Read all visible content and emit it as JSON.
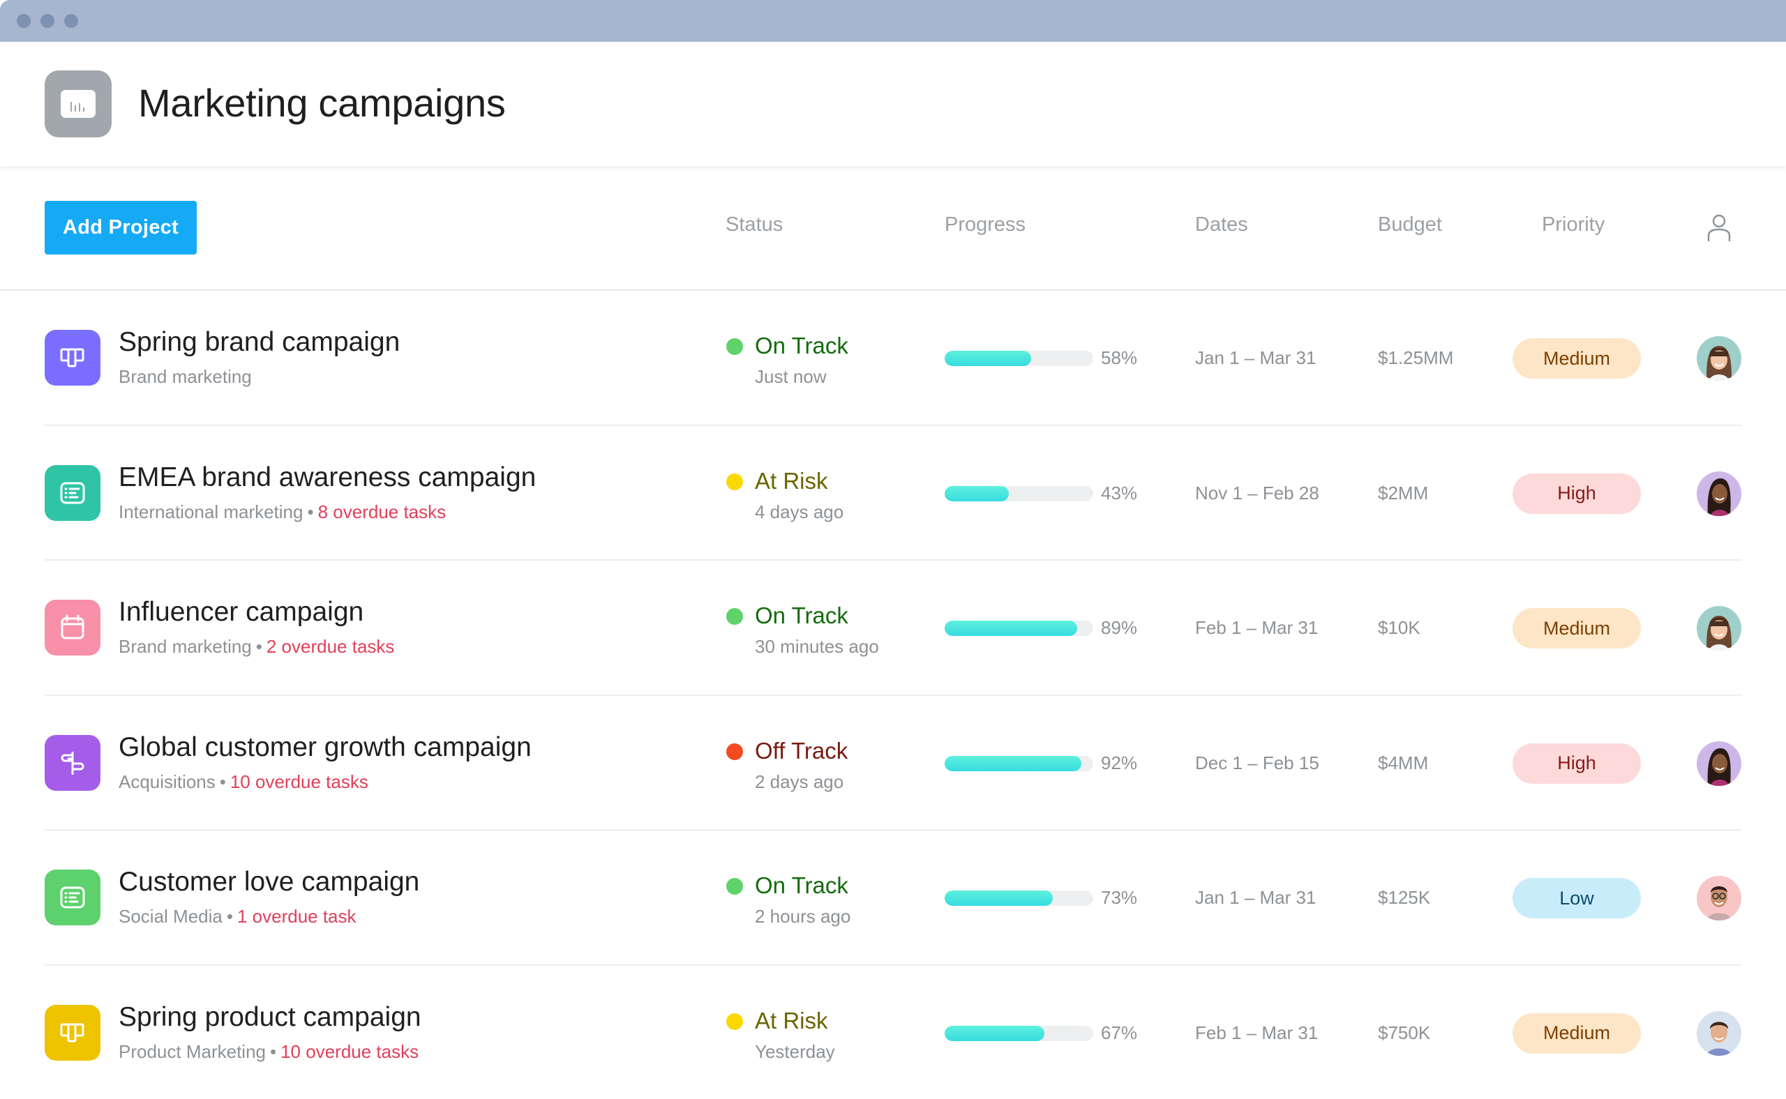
{
  "window": {
    "controls": [
      "close",
      "minimize",
      "maximize"
    ]
  },
  "header": {
    "icon": "bar-chart-icon",
    "title": "Marketing campaigns"
  },
  "toolbar": {
    "add_project_label": "Add Project",
    "columns": {
      "status": "Status",
      "progress": "Progress",
      "dates": "Dates",
      "budget": "Budget",
      "priority": "Priority",
      "assignee_icon": "person-icon"
    }
  },
  "colors": {
    "titlebar": "#a6b6cf",
    "accent": "#14aaf5",
    "overdue": "#e0405a",
    "progress_fill": "#37dce0"
  },
  "projects": [
    {
      "name": "Spring brand campaign",
      "team": "Brand marketing",
      "overdue": "",
      "icon": "board-icon",
      "icon_color": "#796eff",
      "status": "On Track",
      "status_key": "on-track",
      "updated": "Just now",
      "progress": 58,
      "progress_label": "58%",
      "dates": "Jan 1 – Mar 31",
      "budget": "$1.25MM",
      "priority": "Medium",
      "priority_key": "medium",
      "avatar": "woman-bangs"
    },
    {
      "name": "EMEA brand awareness campaign",
      "team": "International marketing",
      "overdue": "8 overdue tasks",
      "icon": "list-icon",
      "icon_color": "#2ec4a5",
      "status": "At Risk",
      "status_key": "at-risk",
      "updated": "4 days ago",
      "progress": 43,
      "progress_label": "43%",
      "dates": "Nov 1 – Feb 28",
      "budget": "$2MM",
      "priority": "High",
      "priority_key": "high",
      "avatar": "woman-long-hair"
    },
    {
      "name": "Influencer campaign",
      "team": "Brand marketing",
      "overdue": "2 overdue tasks",
      "icon": "calendar-icon",
      "icon_color": "#f890a8",
      "status": "On Track",
      "status_key": "on-track",
      "updated": "30 minutes ago",
      "progress": 89,
      "progress_label": "89%",
      "dates": "Feb 1 – Mar 31",
      "budget": "$10K",
      "priority": "Medium",
      "priority_key": "medium",
      "avatar": "woman-bangs"
    },
    {
      "name": "Global customer growth campaign",
      "team": "Acquisitions",
      "overdue": "10 overdue tasks",
      "icon": "signpost-icon",
      "icon_color": "#a45de8",
      "status": "Off Track",
      "status_key": "off-track",
      "updated": "2 days ago",
      "progress": 92,
      "progress_label": "92%",
      "dates": "Dec 1 – Feb 15",
      "budget": "$4MM",
      "priority": "High",
      "priority_key": "high",
      "avatar": "woman-long-hair"
    },
    {
      "name": "Customer love campaign",
      "team": "Social Media",
      "overdue": "1 overdue task",
      "icon": "list-icon",
      "icon_color": "#5cd16d",
      "status": "On Track",
      "status_key": "on-track",
      "updated": "2 hours ago",
      "progress": 73,
      "progress_label": "73%",
      "dates": "Jan 1 – Mar 31",
      "budget": "$125K",
      "priority": "Low",
      "priority_key": "low",
      "avatar": "man-glasses"
    },
    {
      "name": "Spring product campaign",
      "team": "Product Marketing",
      "overdue": "10 overdue tasks",
      "icon": "board-icon",
      "icon_color": "#eec300",
      "status": "At Risk",
      "status_key": "at-risk",
      "updated": "Yesterday",
      "progress": 67,
      "progress_label": "67%",
      "dates": "Feb 1 – Mar 31",
      "budget": "$750K",
      "priority": "Medium",
      "priority_key": "medium",
      "avatar": "man-short-hair"
    }
  ],
  "status_styles": {
    "on-track": {
      "dot": "#5fd36a",
      "text": "#146b0e"
    },
    "at-risk": {
      "dot": "#fad900",
      "text": "#6b6400"
    },
    "off-track": {
      "dot": "#f44a21",
      "text": "#7a1a10"
    }
  },
  "priority_styles": {
    "medium": {
      "bg": "#fde6c7",
      "text": "#7c3f00"
    },
    "high": {
      "bg": "#fdd9d9",
      "text": "#861d1d"
    },
    "low": {
      "bg": "#c9ecfb",
      "text": "#0e4c6d"
    }
  }
}
